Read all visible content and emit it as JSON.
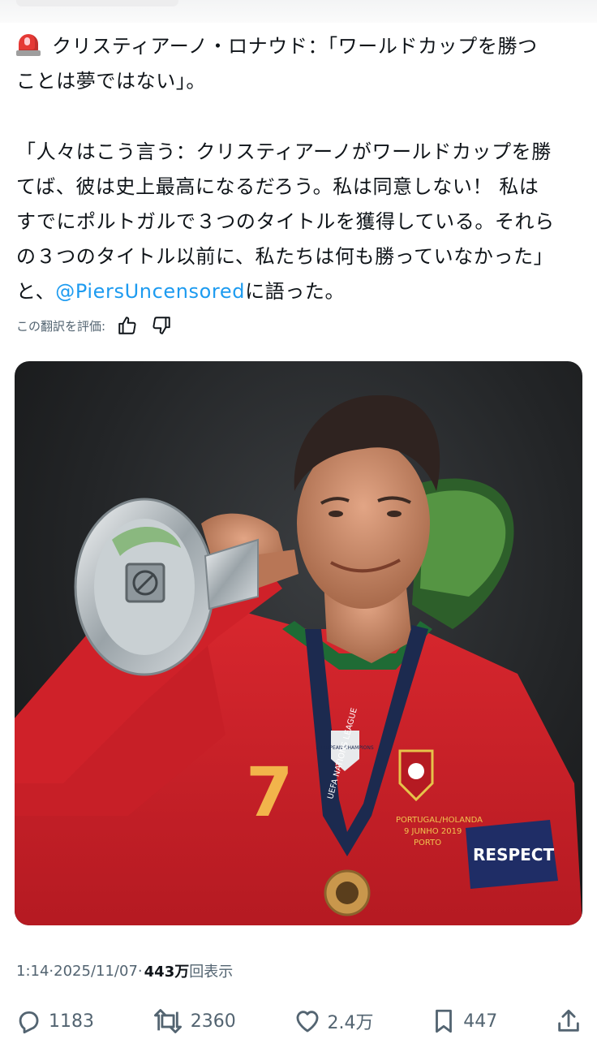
{
  "tweet": {
    "line1": "クリスティアーノ・ロナウド：「ワールドカップを勝つ",
    "line2": "ことは夢ではない」。",
    "quote_line1": "「人々はこう言う：クリスティアーノがワールドカップを勝",
    "quote_line2": "てば、彼は史上最高になるだろう。私は同意しない！ 私は",
    "quote_line3": "すでにポルトガルで３つのタイトルを獲得している。それら",
    "quote_line4": "の３つのタイトル以前に、私たちは何も勝っていなかった」",
    "quote_line5_prefix": "と、",
    "mention": "@PiersUncensored",
    "quote_line5_suffix": "に語った。"
  },
  "translation": {
    "label": "この翻訳を評価:"
  },
  "media": {
    "jersey_number": "7",
    "armband": "RESPECT",
    "lanyard": "UEFA NATIONS LEAGUE",
    "badge_text1": "PORTUGAL/HOLANDA",
    "badge_text2": "9 JUNHO 2019",
    "badge_text3": "PORTO",
    "patch_text": "EUROPEAN CHAMPIONS"
  },
  "meta": {
    "time": "1:14",
    "sep1": " · ",
    "date": "2025/11/07",
    "sep2": " · ",
    "views_count": "443万",
    "views_label": "回表示"
  },
  "actions": {
    "replies": "1183",
    "reposts": "2360",
    "likes": "2.4万",
    "bookmarks": "447"
  },
  "colors": {
    "link": "#1d9bf0",
    "secondary_text": "#536471",
    "jersey": "#d1232a",
    "siren": "#e53935"
  }
}
